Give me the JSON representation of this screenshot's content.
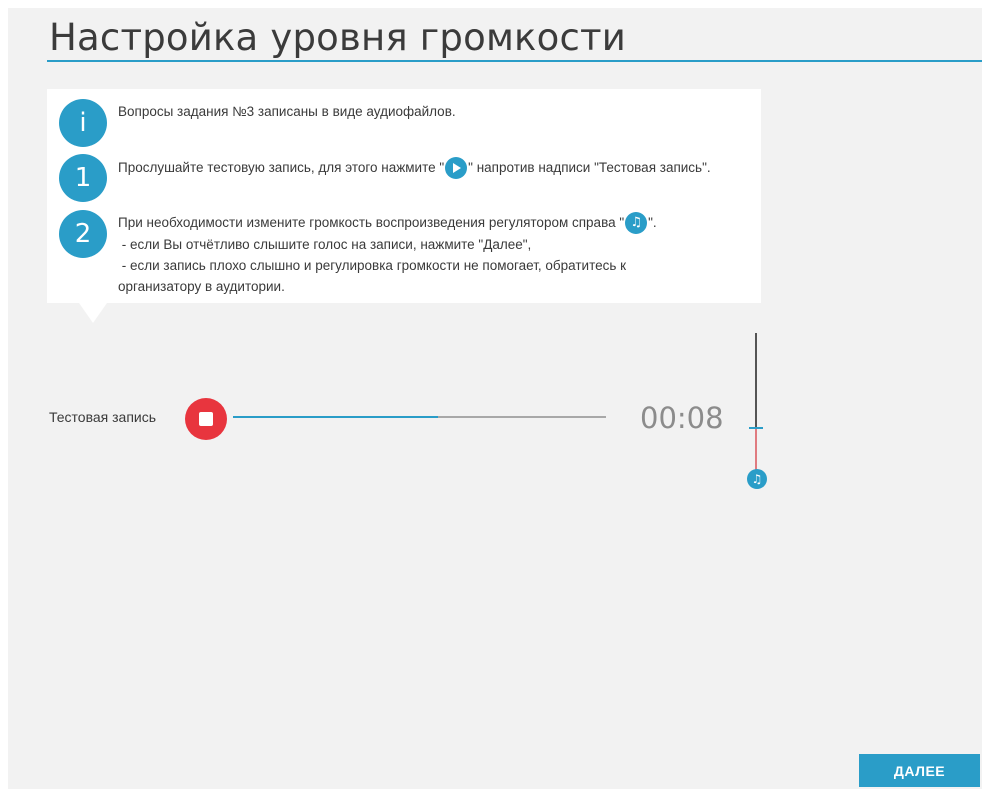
{
  "page": {
    "title": "Настройка уровня громкости"
  },
  "instructions": {
    "steps": [
      {
        "marker": "i",
        "text": "Вопросы задания №3 записаны в виде аудиофайлов."
      },
      {
        "marker": "1",
        "text_before": "Прослушайте тестовую запись, для этого нажмите \"",
        "text_after": "\" напротив надписи \"Тестовая запись\".",
        "icon": "play-icon"
      },
      {
        "marker": "2",
        "text_before": "При необходимости измените громкость воспроизведения регулятором справа \"",
        "text_after": "\".",
        "icon": "music-note-icon",
        "lines": [
          " - если Вы отчётливо слышите голос на записи, нажмите \"Далее\",",
          " - если запись плохо слышно и регулировка громкости не помогает, обратитесь к",
          "организатору в аудитории."
        ]
      }
    ]
  },
  "player": {
    "label": "Тестовая запись",
    "button_icon": "stop-icon",
    "progress": 0.55,
    "time": "00:08"
  },
  "volume": {
    "level": 0.44,
    "icon": "music-note-icon"
  },
  "footer": {
    "next_label": "ДАЛЕЕ"
  },
  "colors": {
    "accent": "#2a9dc8",
    "stop": "#e8353e",
    "volume_low": "#e07b80"
  }
}
